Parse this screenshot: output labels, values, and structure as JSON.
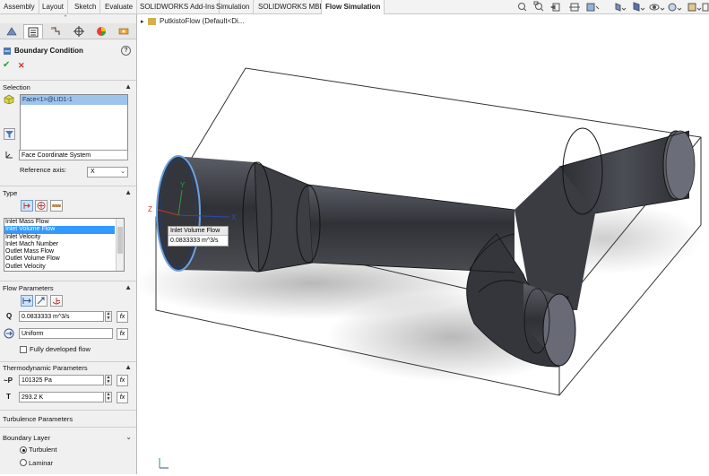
{
  "ribbon": {
    "tabs": [
      "Assembly",
      "Layout",
      "Sketch",
      "Evaluate",
      "SOLIDWORKS Add-Ins",
      "Simulation",
      "SOLIDWORKS MBD",
      "Flow Simulation"
    ],
    "active_tab": "Flow Simulation"
  },
  "tree": {
    "item": "PutkistoFlow  (Default<Di..."
  },
  "panel": {
    "title": "Boundary Condition",
    "help": "?",
    "ok": "✔",
    "cancel": "✕",
    "selection": {
      "header": "Selection",
      "selected_face": "Face<1>@LID1-1",
      "coord_system": "Face Coordinate System",
      "ref_axis_label": "Reference axis:",
      "ref_axis_value": "X"
    },
    "type": {
      "header": "Type",
      "options": [
        "Inlet Mass Flow",
        "Inlet Volume Flow",
        "Inlet Velocity",
        "Inlet Mach Number",
        "Outlet Mass Flow",
        "Outlet Volume Flow",
        "Outlet Velocity"
      ],
      "selected": "Inlet Volume Flow"
    },
    "flow": {
      "header": "Flow Parameters",
      "q_label": "Q",
      "q_value": "0.0833333 m^3/s",
      "profile_value": "Uniform",
      "fully_developed": "Fully developed flow"
    },
    "thermo": {
      "header": "Thermodynamic Parameters",
      "p_label": "~P",
      "p_value": "101325 Pa",
      "t_label": "T",
      "t_value": "293.2 K"
    },
    "turbulence": {
      "header": "Turbulence Parameters"
    },
    "boundary_layer": {
      "header": "Boundary Layer",
      "turbulent": "Turbulent",
      "laminar": "Laminar"
    }
  },
  "callout": {
    "title": "Inlet Volume Flow",
    "value": "0.0833333 m^3/s"
  },
  "axes": {
    "x": "X",
    "y": "Y",
    "z": "Z"
  },
  "colors": {
    "selection_blue": "#9fc4ec",
    "pipe": "#3d3f44",
    "panel_bg": "#f0f0f0"
  }
}
